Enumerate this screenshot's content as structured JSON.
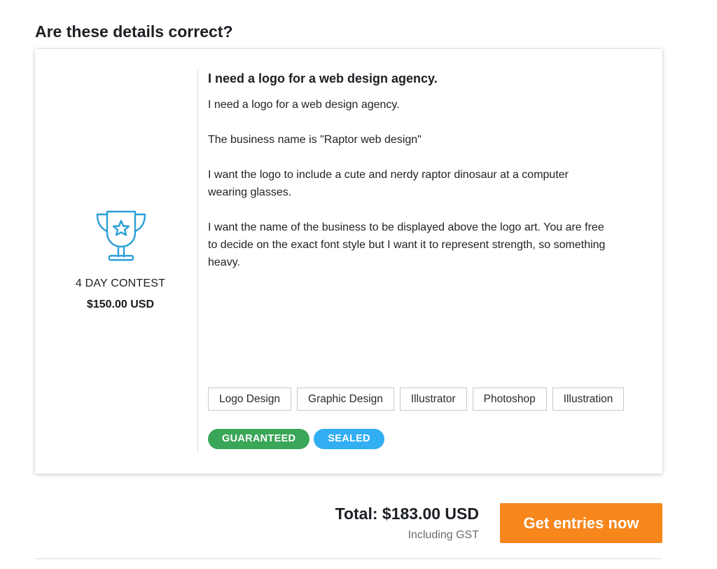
{
  "page": {
    "title": "Are these details correct?"
  },
  "contest": {
    "duration": "4 DAY CONTEST",
    "price": "$150.00 USD",
    "icon": "trophy-icon"
  },
  "brief": {
    "title": "I need a logo for a web design agency.",
    "description": "I need a logo for a web design agency.\n\nThe business name is \"Raptor web design\"\n\nI want the logo to include a cute and nerdy raptor dinosaur at a computer\nwearing glasses.\n\nI want the name of the business to be displayed above the logo art. You are free\nto decide on the exact font style but I want it to represent strength, so something\nheavy."
  },
  "skills": [
    "Logo Design",
    "Graphic Design",
    "Illustrator",
    "Photoshop",
    "Illustration"
  ],
  "badges": {
    "guaranteed": "GUARANTEED",
    "sealed": "SEALED"
  },
  "summary": {
    "total": "Total: $183.00 USD",
    "tax_note": "Including GST",
    "cta_label": "Get entries now"
  },
  "colors": {
    "accent_orange": "#f7861c",
    "guaranteed_green": "#3aa658",
    "sealed_blue": "#32aef2",
    "trophy_blue": "#2a9fd6"
  }
}
